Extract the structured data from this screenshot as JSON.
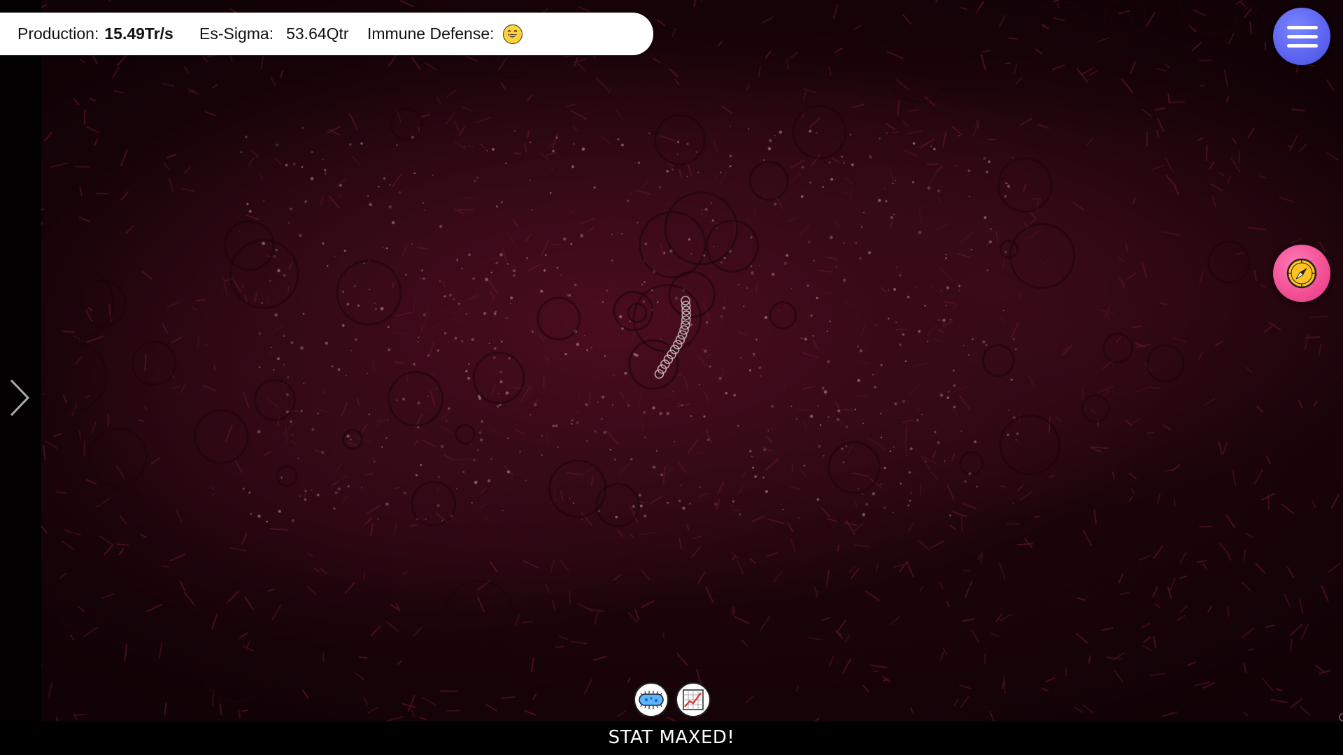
{
  "stats": {
    "production_label": "Production:",
    "production_value": "15.49Tr/s",
    "sigma_label": "Es-Sigma:",
    "sigma_value": "53.64Qtr",
    "immune_label": "Immune Defense:",
    "immune_icon": "laughing-face-icon"
  },
  "buttons": {
    "menu_icon": "hamburger-menu-icon",
    "compass_icon": "compass-icon",
    "expand_icon": "chevron-right-icon",
    "microbe_icon": "microbe-icon",
    "graph_icon": "line-graph-icon"
  },
  "status": {
    "message": "STAT MAXED!"
  },
  "colors": {
    "menu_button": "#5c63f0",
    "compass_button": "#f24e93",
    "background_flesh": "#3a0a18",
    "immune_face": "#ffd23a"
  }
}
